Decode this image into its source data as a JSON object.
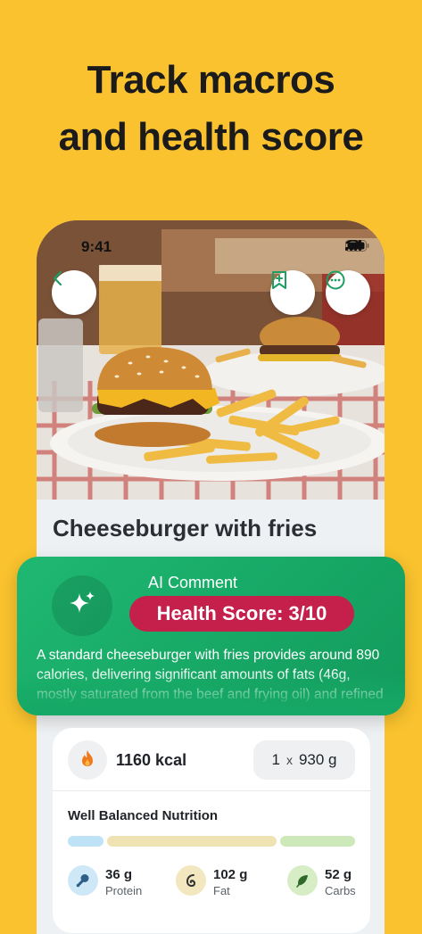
{
  "headline": {
    "line1": "Track macros",
    "line2": "and health score"
  },
  "status_bar": {
    "time": "9:41"
  },
  "food": {
    "title": "Cheeseburger with fries"
  },
  "ai_comment": {
    "label": "AI Comment",
    "health_score": "Health Score: 3/10",
    "text": "A standard cheeseburger with fries provides around 890 calories, delivering significant amounts of fats (46g, mostly saturated from the beef and frying oil) and refined"
  },
  "nutrition": {
    "calories": "1160 kcal",
    "serving_count": "1",
    "serving_x": "x",
    "serving_weight": "930 g",
    "heading": "Well Balanced Nutrition",
    "macros": [
      {
        "value": "36 g",
        "label": "Protein",
        "color": "#bfe3f6"
      },
      {
        "value": "102 g",
        "label": "Fat",
        "color": "#f0e3b3"
      },
      {
        "value": "52 g",
        "label": "Carbs",
        "color": "#cde9b9"
      }
    ]
  },
  "colors": {
    "background": "#F9C22E",
    "ai_card": "#1fb872",
    "health_badge": "#c51f4b",
    "flame": "#f07a1a"
  },
  "icons": [
    "back-icon",
    "bookmark-add-icon",
    "more-icon",
    "sparkle-icon",
    "flame-icon",
    "protein-icon",
    "fat-icon",
    "carbs-icon"
  ]
}
